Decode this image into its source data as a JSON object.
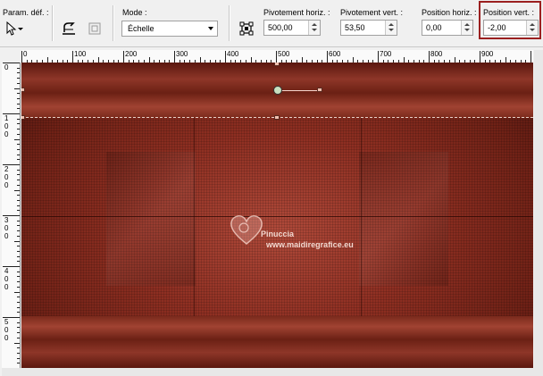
{
  "toolbar": {
    "presets_label": "Param. déf. :",
    "mode_label": "Mode :",
    "mode_value": "Échelle",
    "pivot_h_label": "Pivotement horiz. :",
    "pivot_h_value": "500,00",
    "pivot_v_label": "Pivotement vert. :",
    "pivot_v_value": "53,50",
    "pos_h_label": "Position horiz. :",
    "pos_h_value": "0,00",
    "pos_v_label": "Position vert. :",
    "pos_v_value": "-2,00",
    "highlight_color": "#9b2020"
  },
  "ruler": {
    "top_labels": [
      "0",
      "100",
      "200",
      "300",
      "400",
      "500",
      "600",
      "700",
      "800",
      "900"
    ],
    "left_labels": [
      [
        "0"
      ],
      [
        "1",
        "0",
        "0"
      ],
      [
        "2",
        "0",
        "0"
      ],
      [
        "3",
        "0",
        "0"
      ],
      [
        "4",
        "0",
        "0"
      ],
      [
        "5",
        "0",
        "0"
      ]
    ]
  },
  "watermark": {
    "name": "Pinuccia",
    "url": "www.maidiregrafice.eu"
  },
  "icons": [
    "pick-tool-icon",
    "chevron-down-icon",
    "deform-tool-icon",
    "grid-icon",
    "transform-icon"
  ]
}
